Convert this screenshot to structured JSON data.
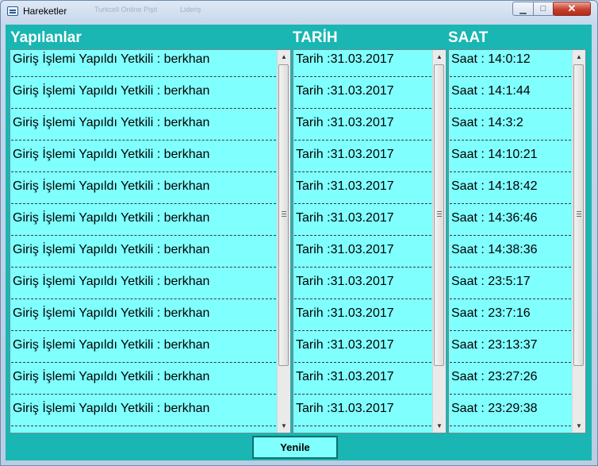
{
  "window": {
    "title": "Hareketler",
    "background_tabs": [
      "Turkcell Online Pişti",
      "Lideriş"
    ]
  },
  "colors": {
    "form_bg": "#19b6b3",
    "list_bg": "#80ffff",
    "header_text": "#ffffff"
  },
  "headers": {
    "actions": "Yapılanlar",
    "date": "TARİH",
    "time": "SAAT"
  },
  "lists": {
    "actions": [
      "Giriş İşlemi Yapıldı Yetkili : berkhan",
      "Giriş İşlemi Yapıldı Yetkili : berkhan",
      "Giriş İşlemi Yapıldı Yetkili : berkhan",
      "Giriş İşlemi Yapıldı Yetkili : berkhan",
      "Giriş İşlemi Yapıldı Yetkili : berkhan",
      "Giriş İşlemi Yapıldı Yetkili : berkhan",
      "Giriş İşlemi Yapıldı Yetkili : berkhan",
      "Giriş İşlemi Yapıldı Yetkili : berkhan",
      "Giriş İşlemi Yapıldı Yetkili : berkhan",
      "Giriş İşlemi Yapıldı Yetkili : berkhan",
      "Giriş İşlemi Yapıldı Yetkili : berkhan",
      "Giriş İşlemi Yapıldı Yetkili : berkhan"
    ],
    "dates": [
      "Tarih :31.03.2017",
      "Tarih :31.03.2017",
      "Tarih :31.03.2017",
      "Tarih :31.03.2017",
      "Tarih :31.03.2017",
      "Tarih :31.03.2017",
      "Tarih :31.03.2017",
      "Tarih :31.03.2017",
      "Tarih :31.03.2017",
      "Tarih :31.03.2017",
      "Tarih :31.03.2017",
      "Tarih :31.03.2017"
    ],
    "times": [
      "Saat : 14:0:12",
      "Saat : 14:1:44",
      "Saat : 14:3:2",
      "Saat : 14:10:21",
      "Saat : 14:18:42",
      "Saat : 14:36:46",
      "Saat : 14:38:36",
      "Saat : 23:5:17",
      "Saat : 23:7:16",
      "Saat : 23:13:37",
      "Saat : 23:27:26",
      "Saat : 23:29:38"
    ]
  },
  "buttons": {
    "refresh": "Yenile"
  }
}
